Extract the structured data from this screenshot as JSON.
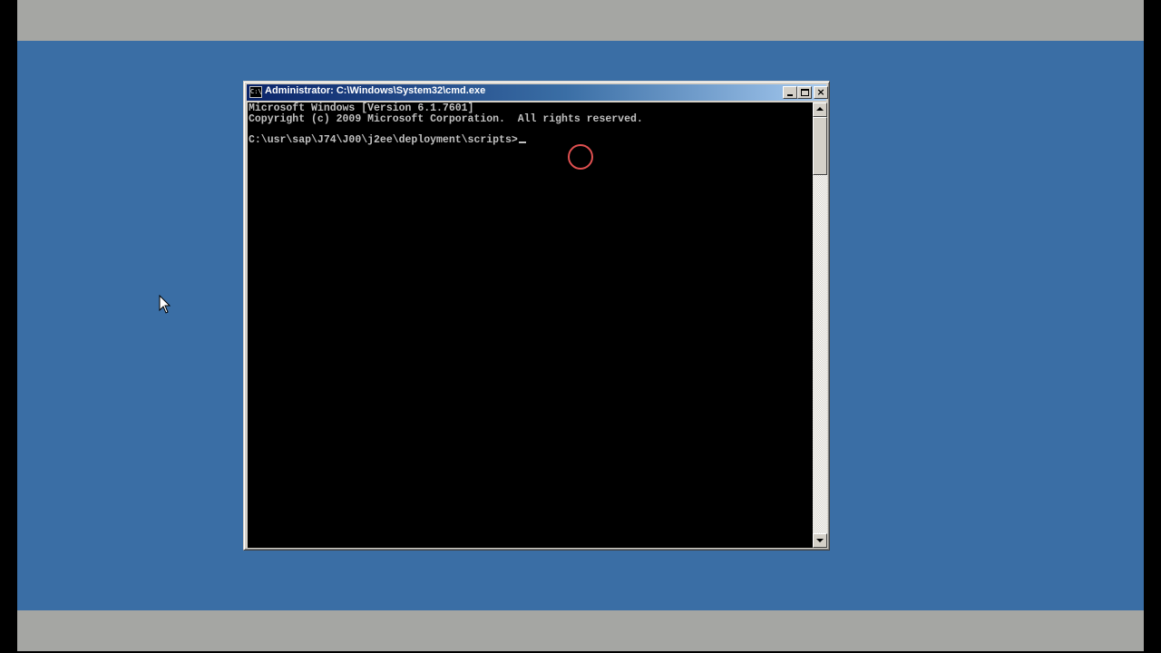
{
  "window": {
    "title": "Administrator: C:\\Windows\\System32\\cmd.exe",
    "icon_text": "C:\\",
    "controls": {
      "minimize": "minimize-icon",
      "maximize": "maximize-icon",
      "close": "close-icon",
      "close_glyph": "×"
    }
  },
  "console": {
    "lines": [
      "Microsoft Windows [Version 6.1.7601]",
      "Copyright (c) 2009 Microsoft Corporation.  All rights reserved.",
      "C:\\usr\\sap\\J74\\J00\\j2ee\\deployment\\scripts>"
    ],
    "text_color": "#c0c0c0",
    "background_color": "#000000"
  },
  "colors": {
    "desktop": "#3a6ea5",
    "title_bar_start": "#0a246a",
    "title_bar_end": "#a6caf0",
    "letterbox": "#a5a6a3",
    "click_indicator": "#e05050"
  },
  "icons": {
    "cursor": "mouse-pointer-icon",
    "scroll_up": "arrow-up-icon",
    "scroll_down": "arrow-down-icon"
  }
}
